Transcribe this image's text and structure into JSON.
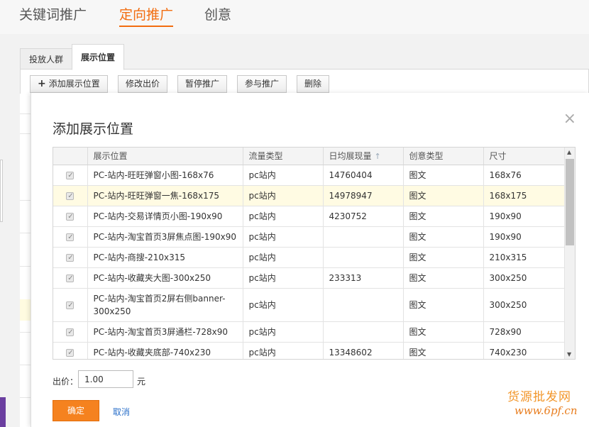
{
  "top_nav": {
    "items": [
      {
        "label": "关键词推广",
        "active": false
      },
      {
        "label": "定向推广",
        "active": true
      },
      {
        "label": "创意",
        "active": false
      }
    ]
  },
  "sub_tabs": [
    {
      "label": "投放人群",
      "active": false
    },
    {
      "label": "展示位置",
      "active": true
    }
  ],
  "toolbar": {
    "add_label": "添加展示位置",
    "edit_price_label": "修改出价",
    "pause_label": "暂停推广",
    "join_label": "参与推广",
    "delete_label": "删除"
  },
  "modal": {
    "title": "添加展示位置",
    "close_icon": "×",
    "columns": [
      "展示位置",
      "流量类型",
      "日均展现量",
      "创意类型",
      "尺寸"
    ],
    "sort_icon": "↑",
    "rows": [
      {
        "checked": true,
        "position": "PC-站内-旺旺弹窗小图-168x76",
        "traffic": "pc站内",
        "daily": "14760404",
        "creative": "图文",
        "size": "168x76",
        "highlight": false
      },
      {
        "checked": true,
        "position": "PC-站内-旺旺弹窗一焦-168x175",
        "traffic": "pc站内",
        "daily": "14978947",
        "creative": "图文",
        "size": "168x175",
        "highlight": true
      },
      {
        "checked": true,
        "position": "PC-站内-交易详情页小图-190x90",
        "traffic": "pc站内",
        "daily": "4230752",
        "creative": "图文",
        "size": "190x90",
        "highlight": false
      },
      {
        "checked": true,
        "position": "PC-站内-淘宝首页3屏焦点图-190x90",
        "traffic": "pc站内",
        "daily": "",
        "creative": "图文",
        "size": "190x90",
        "highlight": false
      },
      {
        "checked": true,
        "position": "PC-站内-商搜-210x315",
        "traffic": "pc站内",
        "daily": "",
        "creative": "图文",
        "size": "210x315",
        "highlight": false
      },
      {
        "checked": true,
        "position": "PC-站内-收藏夹大图-300x250",
        "traffic": "pc站内",
        "daily": "233313",
        "creative": "图文",
        "size": "300x250",
        "highlight": false
      },
      {
        "checked": true,
        "position": "PC-站内-淘宝首页2屏右侧banner-300x250",
        "traffic": "pc站内",
        "daily": "",
        "creative": "图文",
        "size": "300x250",
        "highlight": false
      },
      {
        "checked": true,
        "position": "PC-站内-淘宝首页3屏通栏-728x90",
        "traffic": "pc站内",
        "daily": "",
        "creative": "图文",
        "size": "728x90",
        "highlight": false
      },
      {
        "checked": true,
        "position": "PC-站内-收藏夹底部-740x230",
        "traffic": "pc站内",
        "daily": "13348602",
        "creative": "图文",
        "size": "740x230",
        "highlight": false
      }
    ],
    "price_label": "出价：",
    "price_value": "1.00",
    "price_unit": "元",
    "confirm_label": "确定",
    "cancel_label": "取消"
  },
  "watermark": {
    "top": "货源批发网",
    "bottom": "www.6pf.cn"
  },
  "colors": {
    "accent": "#f26d10",
    "confirm": "#f5821f",
    "link": "#2a6fc9",
    "row_highlight": "#fffbe3"
  }
}
